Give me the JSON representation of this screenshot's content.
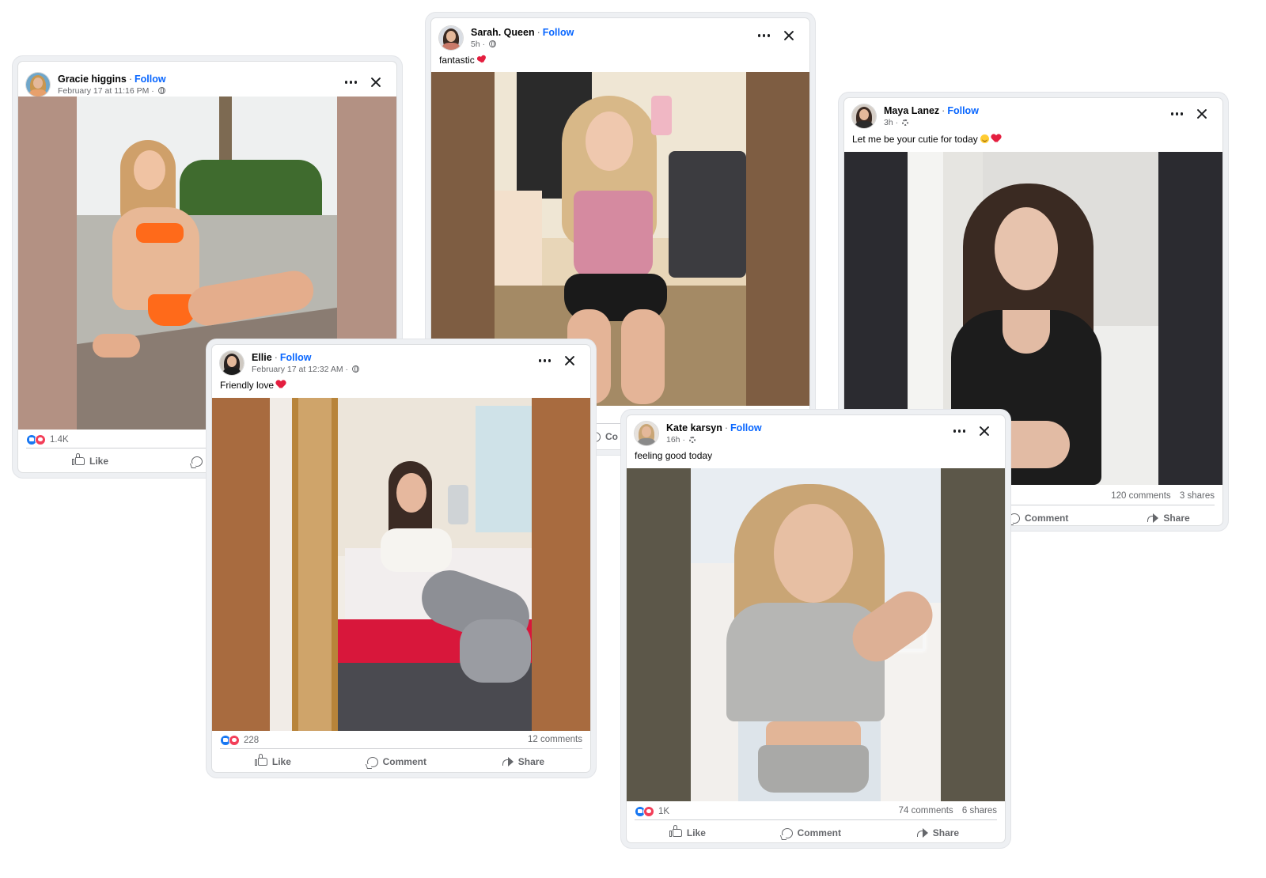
{
  "posts": [
    {
      "id": "gracie",
      "author": "Gracie higgins",
      "follow": "Follow",
      "meta": "February 17 at 11:16 PM",
      "privacy_icon": "globe-icon",
      "caption": "",
      "reactions": "1.4K",
      "comments": "",
      "shares": "",
      "actions": {
        "like": "Like",
        "comment": "Co",
        "share": ""
      },
      "colors": {
        "pad": "#b39183"
      }
    },
    {
      "id": "sarah",
      "author": "Sarah. Queen",
      "follow": "Follow",
      "meta": "5h",
      "privacy_icon": "globe-icon",
      "caption": "fantastic",
      "caption_emoji": "two-hearts-emoji",
      "reactions": "",
      "actions": {
        "comment": "Co"
      },
      "colors": {
        "pad": "#7e5d42"
      }
    },
    {
      "id": "maya",
      "author": "Maya Lanez",
      "follow": "Follow",
      "meta": "3h",
      "privacy_icon": "gear-icon",
      "caption": "Let me be your cutie for today",
      "caption_emoji": [
        "smile-emoji",
        "heart-emoji"
      ],
      "comments": "120 comments",
      "shares": "3 shares",
      "actions": {
        "comment": "Comment",
        "share": "Share"
      },
      "colors": {
        "pad": "#2b2b30"
      }
    },
    {
      "id": "ellie",
      "author": "Ellie",
      "follow": "Follow",
      "meta": "February 17 at 12:32 AM",
      "privacy_icon": "globe-icon",
      "caption": "Friendly love",
      "caption_emoji": "heart-emoji",
      "reactions": "228",
      "comments": "12 comments",
      "shares": "",
      "actions": {
        "like": "Like",
        "comment": "Comment",
        "share": "Share"
      },
      "colors": {
        "pad": "#a86b3f"
      }
    },
    {
      "id": "kate",
      "author": "Kate karsyn",
      "follow": "Follow",
      "meta": "16h",
      "privacy_icon": "gear-icon",
      "caption": "feeling good today",
      "reactions": "1K",
      "comments": "74 comments",
      "shares": "6 shares",
      "actions": {
        "like": "Like",
        "comment": "Comment",
        "share": "Share"
      },
      "colors": {
        "pad": "#5c5749"
      }
    }
  ],
  "theme": {
    "link_blue": "#0866ff",
    "like_blue": "#1877f2",
    "love_red": "#f33e58",
    "muted_text": "#65676b"
  }
}
